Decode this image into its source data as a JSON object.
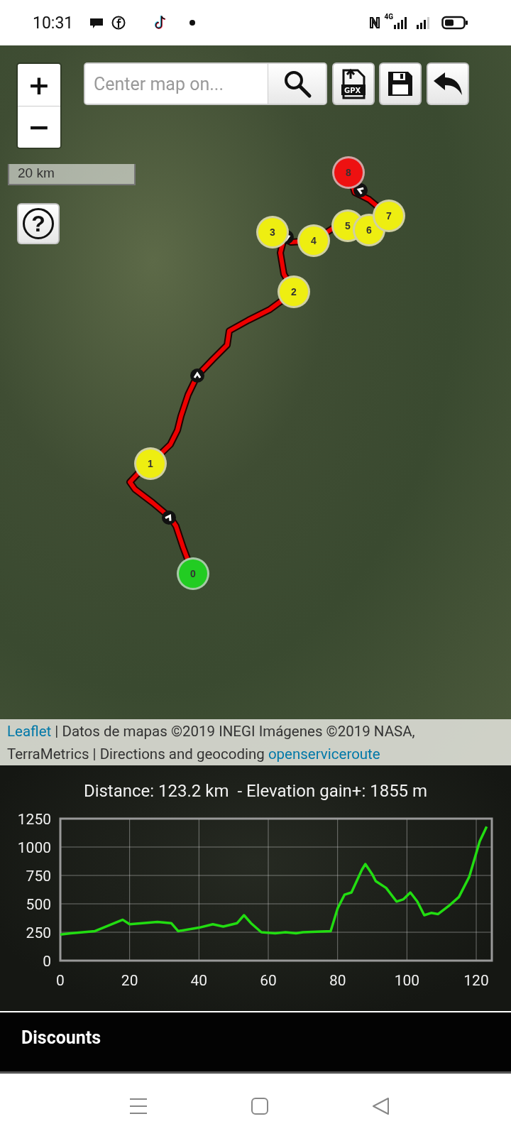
{
  "status_bar": {
    "time": "10:31",
    "network": "4G"
  },
  "map": {
    "zoom_in": "+",
    "zoom_out": "−",
    "search": {
      "placeholder": "Center map on..."
    },
    "gpx_button": "GPX",
    "scale": "20 km",
    "help": "?",
    "markers": [
      {
        "label": "0",
        "color": "#22cc22"
      },
      {
        "label": "1",
        "color": "#eeee11"
      },
      {
        "label": "2",
        "color": "#eeee11"
      },
      {
        "label": "3",
        "color": "#eeee11"
      },
      {
        "label": "4",
        "color": "#eeee11"
      },
      {
        "label": "5",
        "color": "#eeee11"
      },
      {
        "label": "6",
        "color": "#eeee11"
      },
      {
        "label": "7",
        "color": "#eeee11"
      },
      {
        "label": "8",
        "color": "#ee1111"
      }
    ],
    "attribution": [
      {
        "text": "Leaflet",
        "link": true
      },
      {
        "text": " | Datos de mapas ©2019 INEGI Imágenes ©2019 NASA, TerraMetrics | Directions and geocoding ",
        "link": false
      },
      {
        "text": "openserviceroute",
        "link": true
      }
    ]
  },
  "elevation": {
    "summary": "Distance: 123.2 km  - Elevation gain+: 1855 m",
    "chart_data": {
      "type": "line",
      "xlim": [
        0,
        124.5
      ],
      "ylim": [
        0,
        1250
      ],
      "xticks": [
        0,
        20,
        40,
        60,
        80,
        100,
        120
      ],
      "yticks": [
        0,
        250,
        500,
        750,
        1000,
        1250
      ],
      "grid": true,
      "series": [
        {
          "color": "#22dd11",
          "x": [
            0,
            3,
            10,
            18,
            20,
            28,
            32,
            34,
            40,
            44,
            47,
            51,
            53,
            55,
            58,
            62,
            65,
            68,
            70,
            78,
            80,
            82,
            84,
            87,
            88,
            90,
            91,
            94,
            97,
            99,
            101,
            103,
            105,
            107,
            109,
            112,
            115,
            118,
            121,
            123
          ],
          "values": [
            230,
            240,
            260,
            360,
            320,
            340,
            330,
            260,
            290,
            320,
            300,
            330,
            400,
            330,
            250,
            240,
            250,
            240,
            250,
            260,
            460,
            580,
            600,
            800,
            850,
            760,
            700,
            640,
            520,
            540,
            600,
            520,
            400,
            420,
            410,
            480,
            560,
            740,
            1050,
            1180
          ]
        }
      ]
    }
  },
  "section": {
    "title": "Discounts"
  }
}
